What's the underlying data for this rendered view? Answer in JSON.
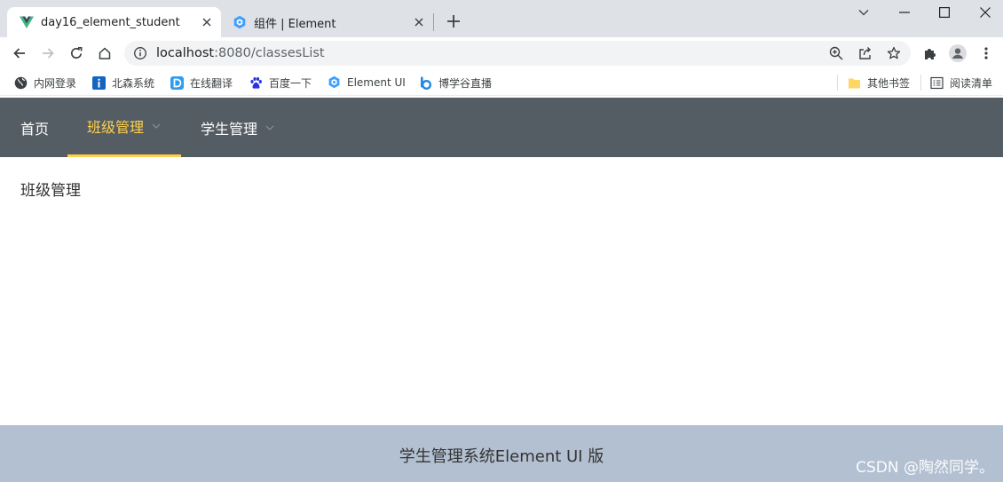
{
  "browser": {
    "tabs": [
      {
        "title": "day16_element_student",
        "active": true,
        "favicon": "vue-logo-icon"
      },
      {
        "title": "组件 | Element",
        "active": false,
        "favicon": "element-logo-icon"
      }
    ],
    "address": {
      "host": "localhost",
      "rest": ":8080/classesList"
    },
    "bookmarks": [
      {
        "label": "内网登录",
        "icon": "globe-icon"
      },
      {
        "label": "北森系统",
        "icon": "info-tile-icon"
      },
      {
        "label": "在线翻译",
        "icon": "translate-d-icon"
      },
      {
        "label": "百度一下",
        "icon": "baidu-paw-icon"
      },
      {
        "label": "Element UI",
        "icon": "element-logo-icon"
      },
      {
        "label": "博学谷直播",
        "icon": "boxuegu-icon"
      }
    ],
    "bookmarks_right": [
      {
        "label": "其他书签",
        "icon": "folder-icon"
      },
      {
        "label": "阅读清单",
        "icon": "reading-list-icon"
      }
    ]
  },
  "app": {
    "menu": [
      {
        "label": "首页",
        "active": false,
        "has_submenu": false
      },
      {
        "label": "班级管理",
        "active": true,
        "has_submenu": true
      },
      {
        "label": "学生管理",
        "active": false,
        "has_submenu": true
      }
    ],
    "page_title": "班级管理",
    "footer": "学生管理系统Element UI 版",
    "colors": {
      "nav_bg": "#545c64",
      "nav_active": "#ffd04b",
      "footer_bg": "#b3c0d1"
    }
  },
  "watermark": "CSDN @陶然同学。"
}
